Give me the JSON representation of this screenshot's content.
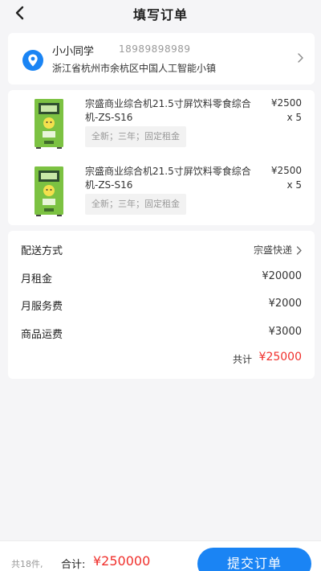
{
  "header": {
    "title": "填写订单"
  },
  "address": {
    "name": "小小同学",
    "phone": "18989898989",
    "detail": "浙江省杭州市余杭区中国人工智能小镇"
  },
  "goods": [
    {
      "name": "宗盛商业综合机21.5寸屏饮料零食综合机-ZS-S16",
      "spec": "全新；三年；固定租金",
      "price": "¥2500",
      "qty": "x 5"
    },
    {
      "name": "宗盛商业综合机21.5寸屏饮料零食综合机-ZS-S16",
      "spec": "全新；三年；固定租金",
      "price": "¥2500",
      "qty": "x 5"
    }
  ],
  "fees": {
    "shipping_label": "配送方式",
    "shipping_value": "宗盛快递",
    "rent_label": "月租金",
    "rent_value": "¥20000",
    "service_label": "月服务费",
    "service_value": "¥2000",
    "freight_label": "商品运费",
    "freight_value": "¥3000",
    "total_label": "共计",
    "total_value": "¥25000"
  },
  "footer": {
    "count": "共18件,",
    "sum_label": "合计:",
    "sum_value": "¥250000",
    "submit_label": "提交订单"
  },
  "colors": {
    "accent": "#1a84f4",
    "price_red": "#f0302c",
    "machine_green": "#7cc242"
  },
  "icons": [
    "back-arrow-icon",
    "location-pin-icon",
    "chevron-right-icon"
  ]
}
